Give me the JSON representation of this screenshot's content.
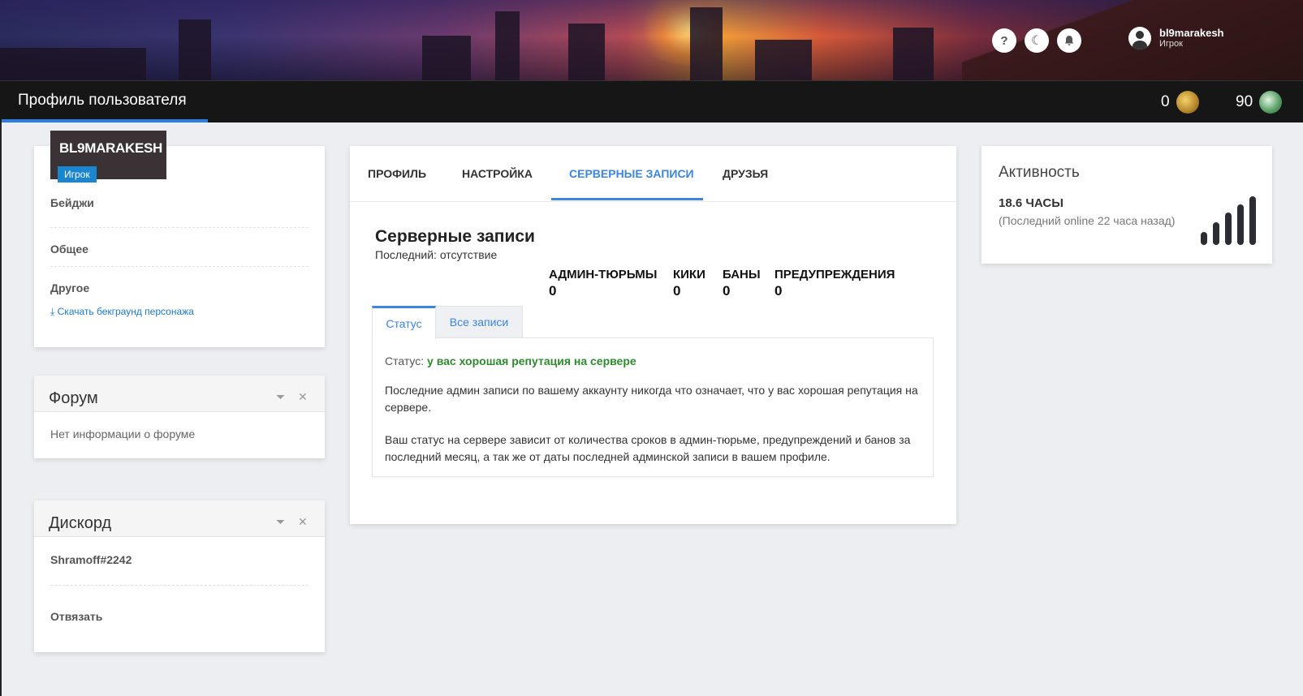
{
  "header": {
    "icons": [
      {
        "name": "help-icon",
        "glyph": "?"
      },
      {
        "name": "moon-icon",
        "glyph": "☾"
      },
      {
        "name": "bell-icon",
        "glyph": "🔔"
      }
    ],
    "user": {
      "name": "bl9marakesh",
      "role": "Игрок"
    }
  },
  "titlebar": {
    "title": "Профиль пользователя",
    "stat_gold": "0",
    "stat_green": "90"
  },
  "profile_card": {
    "nickname": "BL9MARAKESH",
    "role_badge": "Игрок",
    "badges_label": "Бейджи",
    "general_label": "Общее",
    "other_label": "Другое",
    "download_link": "⤓ Скачать бекграунд персонажа"
  },
  "forum_widget": {
    "title": "Форум",
    "text": "Нет информации о форуме",
    "collapse_glyph": "⏷",
    "close_glyph": "✕"
  },
  "discord_widget": {
    "title": "Дискорд",
    "account": "Shramoff#2242",
    "unlink_label": "Отвязать",
    "collapse_glyph": "⏷",
    "close_glyph": "✕"
  },
  "main": {
    "tabs": [
      "ПРОФИЛЬ",
      "НАСТРОЙКА",
      "СЕРВЕРНЫЕ ЗАПИСИ",
      "ДРУЗЬЯ"
    ],
    "active_tab": "СЕРВЕРНЫЕ ЗАПИСИ",
    "section_title": "Серверные записи",
    "section_subtitle": "Последний: отсутствие",
    "counters": [
      {
        "label": "АДМИН-ТЮРЬМЫ",
        "value": "0"
      },
      {
        "label": "КИКИ",
        "value": "0"
      },
      {
        "label": "БАНЫ",
        "value": "0"
      },
      {
        "label": "ПРЕДУПРЕЖДЕНИЯ",
        "value": "0"
      }
    ],
    "subtabs": [
      "Статус",
      "Все записи"
    ],
    "status_prefix": "Статус: ",
    "status_value": "у вас хорошая репутация на сервере",
    "paragraph_1": "Последние админ записи по вашему аккаунту никогда что означает, что у вас хорошая репутация на сервере.",
    "paragraph_2": "Ваш статус на сервере зависит от количества сроков в админ-тюрьме, предупреждений и банов за последний месяц, а так же от даты последней админской записи в вашем профиле."
  },
  "activity": {
    "title": "Активность",
    "hours": "18.6 ЧАСЫ",
    "last_online": "(Последний online 22 часа назад)",
    "signal_level": 1.0
  },
  "colors": {
    "accent": "#3a86e0",
    "good_status": "#2e8b2e",
    "titlebar_bg": "#161616",
    "page_bg": "#eceef2"
  }
}
